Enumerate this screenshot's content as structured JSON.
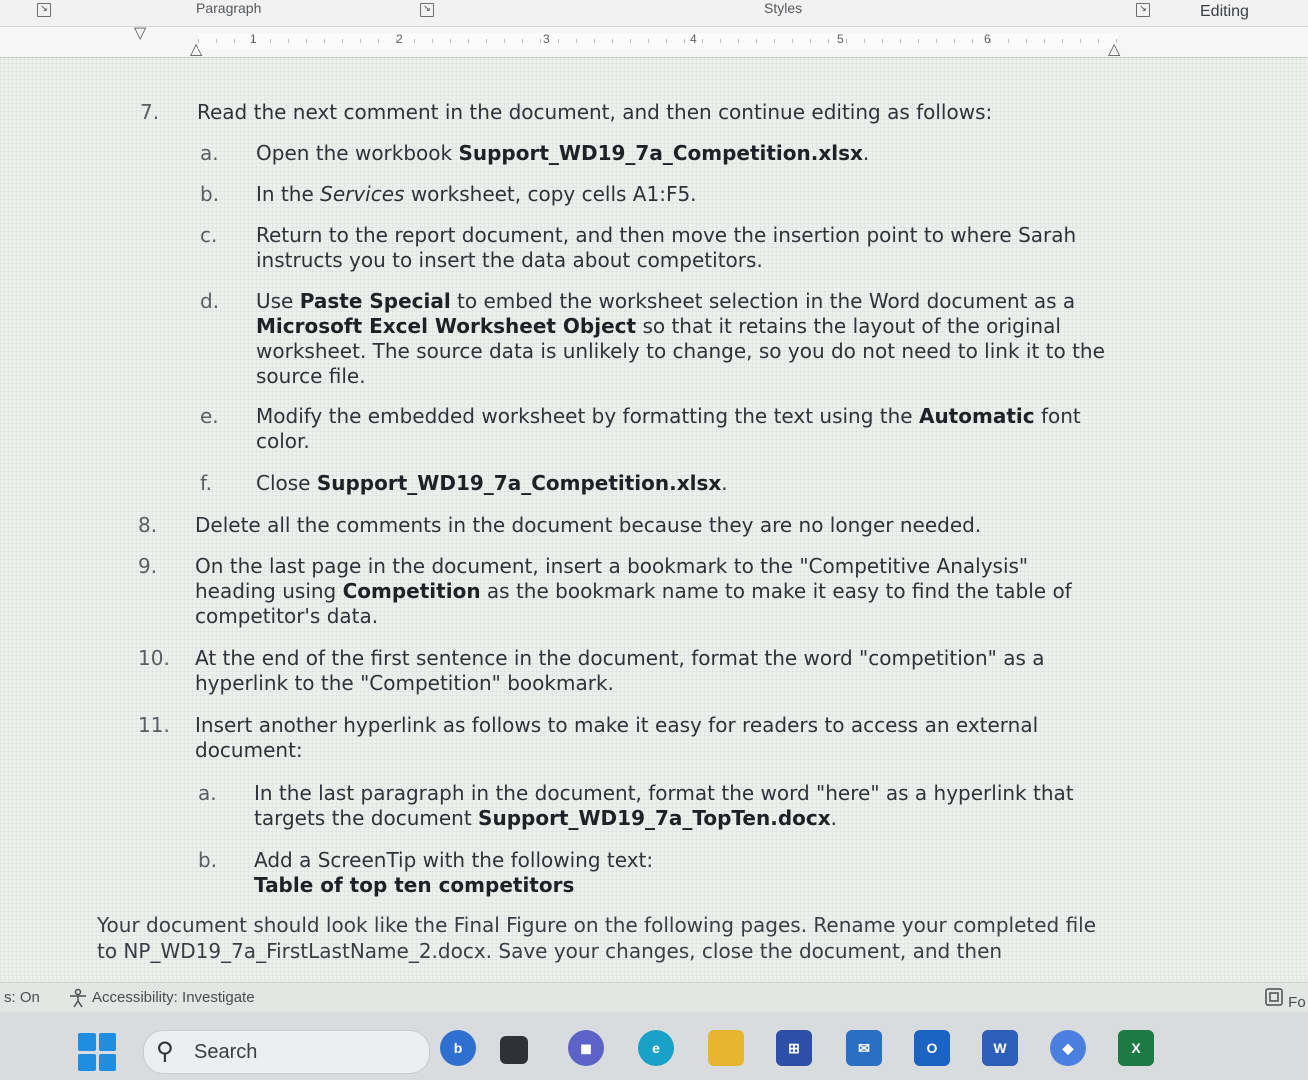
{
  "ribbon": {
    "paragraph_group": "Paragraph",
    "styles_group": "Styles",
    "editing_label": "Editing"
  },
  "ruler": {
    "numbers": [
      "1",
      "2",
      "3",
      "4",
      "5",
      "6"
    ]
  },
  "document": {
    "items": [
      {
        "num": "7.",
        "text": "Read the next comment in the document, and then continue editing as follows:"
      },
      {
        "num": "a.",
        "html": "Open the workbook <b>Support_WD19_7a_Competition.xlsx</b>."
      },
      {
        "num": "b.",
        "html": "In the <i>Services</i> worksheet, copy cells A1:F5."
      },
      {
        "num": "c.",
        "text": "Return to the report document, and then move the insertion point to where Sarah instructs you to insert the data about competitors."
      },
      {
        "num": "d.",
        "html": "Use <b>Paste Special</b> to embed the worksheet selection in the Word document as a <b>Microsoft Excel Worksheet Object</b> so that it retains the layout of the original worksheet. The source data is unlikely to change, so you do not need to link it to the source file."
      },
      {
        "num": "e.",
        "html": "Modify the embedded worksheet by formatting the text using the <b>Automatic</b> font color."
      },
      {
        "num": "f.",
        "html": "Close <b>Support_WD19_7a_Competition.xlsx</b>."
      },
      {
        "num": "8.",
        "text": "Delete all the comments in the document because they are no longer needed."
      },
      {
        "num": "9.",
        "html": "On the last page in the document, insert a bookmark to the \"Competitive Analysis\" heading using <b>Competition</b> as the bookmark name to make it easy to find the table of competitor's data."
      },
      {
        "num": "10.",
        "text": "At the end of the first sentence in the document, format the word \"competition\" as a hyperlink to the \"Competition\" bookmark."
      },
      {
        "num": "11.",
        "text": "Insert another hyperlink as follows to make it easy for readers to access an external document:"
      },
      {
        "num": "a.",
        "html": "In the last paragraph in the document, format the word \"here\" as a hyperlink that targets the document <b>Support_WD19_7a_TopTen.docx</b>."
      },
      {
        "num": "b.",
        "html": "Add a ScreenTip with the following text:<br><b>Table of top ten competitors</b>"
      }
    ],
    "closing": "Your document should look like the Final Figure on the following pages. Rename your completed file to NP_WD19_7a_FirstLastName_2.docx. Save your changes, close the document, and then"
  },
  "statusbar": {
    "left_fragment": "s: On",
    "accessibility": "Accessibility: Investigate",
    "focus_fragment": "Fo"
  },
  "taskbar": {
    "search_placeholder": "Search",
    "apps": [
      "bing-chat",
      "file-explorer-mini",
      "teams-chat",
      "edge",
      "file-explorer",
      "microsoft-store",
      "mail",
      "outlook",
      "word",
      "copilot",
      "excel"
    ]
  },
  "colors": {
    "accent_blue": "#1f8de0",
    "word_blue": "#2b5fb8",
    "excel_green": "#1e7a45"
  }
}
